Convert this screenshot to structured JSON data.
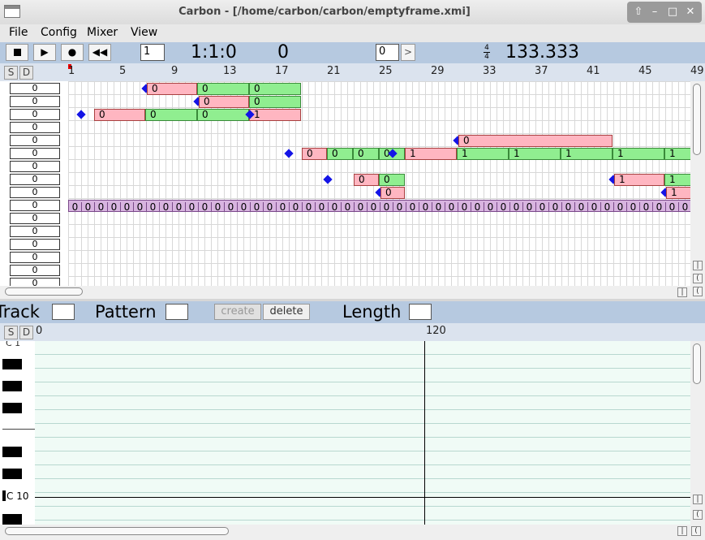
{
  "window": {
    "title": "Carbon - [/home/carbon/carbon/emptyframe.xmi]"
  },
  "menu": [
    "File",
    "Config",
    "Mixer",
    "View"
  ],
  "toolbar": {
    "stop_icon": "stop-icon",
    "play_icon": "play-icon",
    "record_icon": "record-icon",
    "rewind_icon": "rewind-icon",
    "step_value": "1",
    "position": "1:1:0",
    "counter": "0",
    "pattern_value": "0",
    "next_label": ">",
    "time_sig_top": "4",
    "time_sig_bottom": "4",
    "tempo": "133.333"
  },
  "ruler": {
    "solo_label": "S",
    "drum_label": "D",
    "marks": [
      "1",
      "5",
      "9",
      "13",
      "17",
      "21",
      "25",
      "29",
      "33",
      "37",
      "41",
      "45",
      "49"
    ]
  },
  "tracks": {
    "inputs": [
      "0",
      "0",
      "0",
      "0",
      "0",
      "0",
      "0",
      "0",
      "0",
      "0",
      "0",
      "0",
      "0",
      "0",
      "0",
      "0"
    ],
    "row1": [
      "0",
      "0",
      "0"
    ],
    "row2": [
      "0",
      "0"
    ],
    "row3": [
      "0",
      "0",
      "0",
      "1"
    ],
    "row5": [
      "0"
    ],
    "row6": [
      "0",
      "0",
      "0",
      "0",
      "1",
      "1",
      "1",
      "1",
      "1",
      "1"
    ],
    "row8": [
      "0",
      "0",
      "1",
      "1"
    ],
    "row9": [
      "0",
      "1"
    ],
    "row10_value": "0"
  },
  "pattern_bar": {
    "track_label": "Track",
    "pattern_label": "Pattern",
    "create_label": "create",
    "delete_label": "delete",
    "length_label": "Length"
  },
  "piano": {
    "solo_label": "S",
    "drum_label": "D",
    "ruler_start": "0",
    "ruler_mid": "120",
    "key_top_label": "C 1",
    "key_label": "C 10"
  }
}
